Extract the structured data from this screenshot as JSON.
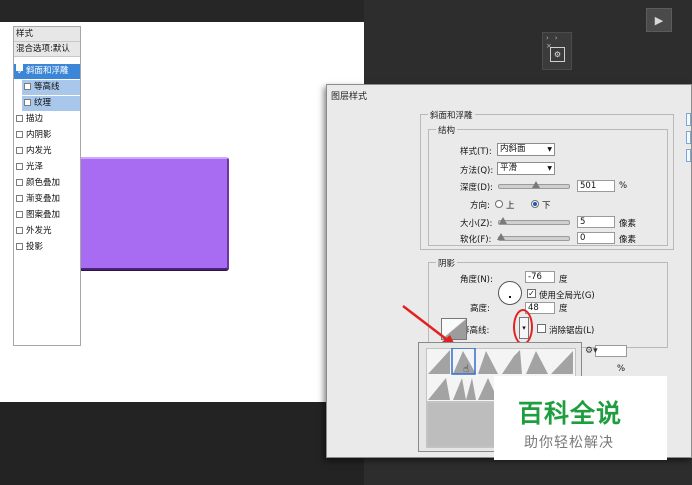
{
  "app": {
    "play_icon": "play-triangle",
    "mini_panel": {
      "controls": "›› ×",
      "icon": "panel-icon"
    }
  },
  "dialog": {
    "title": "图层样式",
    "left_panel": {
      "items": [
        {
          "label": "样式",
          "checkbox": false
        },
        {
          "label": "混合选项:默认",
          "checkbox": false
        },
        {
          "label": "斜面和浮雕",
          "checkbox": true,
          "checked": true,
          "selected": true
        },
        {
          "label": "等高线",
          "checkbox": true,
          "checked": false,
          "sub": true
        },
        {
          "label": "纹理",
          "checkbox": true,
          "checked": false,
          "sub": true
        },
        {
          "label": "描边",
          "checkbox": true,
          "checked": false
        },
        {
          "label": "内阴影",
          "checkbox": true,
          "checked": false
        },
        {
          "label": "内发光",
          "checkbox": true,
          "checked": false
        },
        {
          "label": "光泽",
          "checkbox": true,
          "checked": false
        },
        {
          "label": "颜色叠加",
          "checkbox": true,
          "checked": false
        },
        {
          "label": "渐变叠加",
          "checkbox": true,
          "checked": false
        },
        {
          "label": "图案叠加",
          "checkbox": true,
          "checked": false
        },
        {
          "label": "外发光",
          "checkbox": true,
          "checked": false
        },
        {
          "label": "投影",
          "checkbox": true,
          "checked": false
        }
      ]
    },
    "bevel": {
      "section_title": "斜面和浮雕",
      "structure_title": "结构",
      "style_label": "样式(T):",
      "style_value": "内斜面",
      "technique_label": "方法(Q):",
      "technique_value": "平滑",
      "depth_label": "深度(D):",
      "depth_value": "501",
      "depth_unit": "%",
      "direction_label": "方向:",
      "direction_up": "上",
      "direction_down": "下",
      "size_label": "大小(Z):",
      "size_value": "5",
      "size_unit": "像素",
      "soften_label": "软化(F):",
      "soften_value": "0",
      "soften_unit": "像素"
    },
    "shading": {
      "title": "阴影",
      "angle_label": "角度(N):",
      "angle_value": "-76",
      "angle_unit": "度",
      "global_light_label": "使用全局光(G)",
      "altitude_label": "高度:",
      "altitude_value": "48",
      "altitude_unit": "度",
      "gloss_contour_label": "光泽等高线:",
      "anti_alias_label": "消除锯齿(L)",
      "fragment_pct": "%"
    }
  },
  "watermark": {
    "title": "百科全说",
    "subtitle": "助你轻松解决",
    "color": "#1f9e3f"
  },
  "colors": {
    "shape_fill": "#a86cf3",
    "selection_blue": "#3c86d8",
    "highlight_red": "#e22121"
  }
}
